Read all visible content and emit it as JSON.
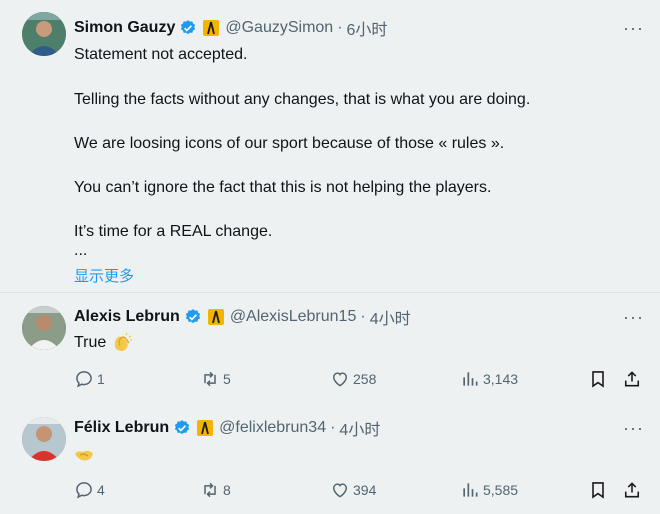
{
  "posts": [
    {
      "name": "Simon Gauzy",
      "handle": "@GauzySimon",
      "sep": "·",
      "time": "6小时",
      "lines": [
        "Statement not accepted.",
        "Telling the facts without any changes, that is what you are doing.",
        "We are loosing icons of our sport because of those « rules ».",
        "You can’t ignore the fact that this is not helping the players.",
        "It’s time for a REAL change.",
        "..."
      ],
      "show_more": "显示更多"
    },
    {
      "name": "Alexis Lebrun",
      "handle": "@AlexisLebrun15",
      "sep": "·",
      "time": "4小时",
      "text": "True",
      "emoji": "clapping-hands",
      "replies": "1",
      "reposts": "5",
      "likes": "258",
      "views": "3,143"
    },
    {
      "name": "Félix Lebrun",
      "handle": "@felixlebrun34",
      "sep": "·",
      "time": "4小时",
      "emoji": "handshake",
      "replies": "4",
      "reposts": "8",
      "likes": "394",
      "views": "5,585"
    }
  ],
  "more_glyph": "···",
  "colors": {
    "verified": "#1d9bf0",
    "badge": "#f5b400",
    "link": "#1d9bf0",
    "muted": "#536471"
  }
}
